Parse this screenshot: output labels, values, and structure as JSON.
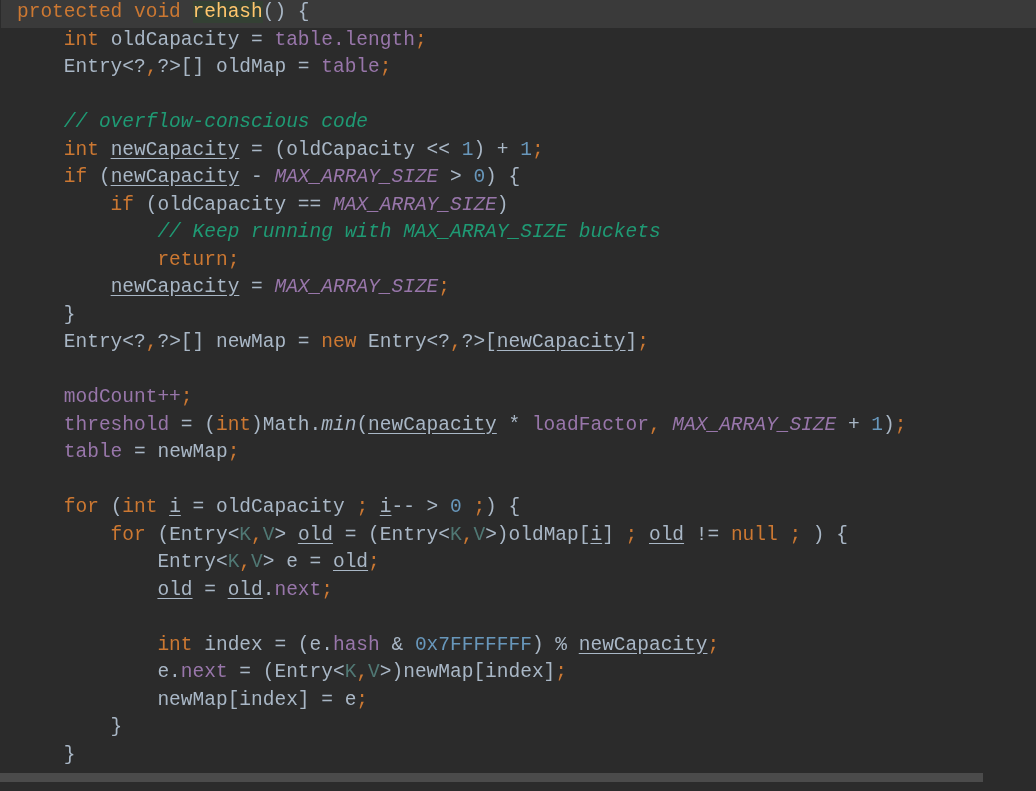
{
  "editor": {
    "lines": [
      {
        "current": true,
        "tokens": [
          {
            "kind": "keyword",
            "text": "protected void "
          },
          {
            "kind": "method_declaration",
            "text": "rehash"
          },
          {
            "kind": "plain",
            "text": "() {"
          }
        ]
      },
      {
        "current": false,
        "tokens": [
          {
            "kind": "keyword",
            "text": "    int "
          },
          {
            "kind": "plain",
            "text": "oldCapacity = "
          },
          {
            "kind": "field",
            "text": "table.length"
          },
          {
            "kind": "keyword",
            "text": ";"
          }
        ]
      },
      {
        "current": false,
        "tokens": [
          {
            "kind": "plain",
            "text": "    Entry<?"
          },
          {
            "kind": "keyword",
            "text": ","
          },
          {
            "kind": "plain",
            "text": "?>[] oldMap = "
          },
          {
            "kind": "field",
            "text": "table"
          },
          {
            "kind": "keyword",
            "text": ";"
          }
        ]
      },
      {
        "current": false
      },
      {
        "current": false,
        "tokens": [
          {
            "kind": "comment",
            "text": "    // overflow-conscious code"
          }
        ]
      },
      {
        "current": false,
        "tokens": [
          {
            "kind": "keyword",
            "text": "    int "
          },
          {
            "kind": "reassigned",
            "text": "newCapacity"
          },
          {
            "kind": "plain",
            "text": " = (oldCapacity << "
          },
          {
            "kind": "number",
            "text": "1"
          },
          {
            "kind": "plain",
            "text": ") + "
          },
          {
            "kind": "number",
            "text": "1"
          },
          {
            "kind": "keyword",
            "text": ";"
          }
        ]
      },
      {
        "current": false,
        "tokens": [
          {
            "kind": "keyword",
            "text": "    if "
          },
          {
            "kind": "plain",
            "text": "("
          },
          {
            "kind": "reassigned",
            "text": "newCapacity"
          },
          {
            "kind": "plain",
            "text": " - "
          },
          {
            "kind": "constant",
            "text": "MAX_ARRAY_SIZE"
          },
          {
            "kind": "plain",
            "text": " > "
          },
          {
            "kind": "number",
            "text": "0"
          },
          {
            "kind": "plain",
            "text": ") {"
          }
        ]
      },
      {
        "current": false,
        "tokens": [
          {
            "kind": "keyword",
            "text": "        if "
          },
          {
            "kind": "plain",
            "text": "(oldCapacity == "
          },
          {
            "kind": "constant",
            "text": "MAX_ARRAY_SIZE"
          },
          {
            "kind": "plain",
            "text": ")"
          }
        ]
      },
      {
        "current": false,
        "tokens": [
          {
            "kind": "comment",
            "text": "            // Keep running with MAX_ARRAY_SIZE buckets"
          }
        ]
      },
      {
        "current": false,
        "tokens": [
          {
            "kind": "keyword",
            "text": "            return;"
          }
        ]
      },
      {
        "current": false,
        "tokens": [
          {
            "kind": "reassigned",
            "text": "        newCapacity"
          },
          {
            "kind": "plain",
            "text": " = "
          },
          {
            "kind": "constant",
            "text": "MAX_ARRAY_SIZE"
          },
          {
            "kind": "keyword",
            "text": ";"
          }
        ]
      },
      {
        "current": false,
        "tokens": [
          {
            "kind": "plain",
            "text": "    }"
          }
        ]
      },
      {
        "current": false,
        "tokens": [
          {
            "kind": "plain",
            "text": "    Entry<?"
          },
          {
            "kind": "keyword",
            "text": ","
          },
          {
            "kind": "plain",
            "text": "?>[] newMap = "
          },
          {
            "kind": "keyword",
            "text": "new "
          },
          {
            "kind": "plain",
            "text": "Entry<?"
          },
          {
            "kind": "keyword",
            "text": ","
          },
          {
            "kind": "plain",
            "text": "?>["
          },
          {
            "kind": "reassigned",
            "text": "newCapacity"
          },
          {
            "kind": "plain",
            "text": "]"
          },
          {
            "kind": "keyword",
            "text": ";"
          }
        ]
      },
      {
        "current": false
      },
      {
        "current": false,
        "tokens": [
          {
            "kind": "field",
            "text": "    modCount++"
          },
          {
            "kind": "keyword",
            "text": ";"
          }
        ]
      },
      {
        "current": false,
        "tokens": [
          {
            "kind": "field",
            "text": "    threshold"
          },
          {
            "kind": "plain",
            "text": " = ("
          },
          {
            "kind": "keyword",
            "text": "int"
          },
          {
            "kind": "plain",
            "text": ")Math."
          },
          {
            "kind": "static_method",
            "text": "min"
          },
          {
            "kind": "plain",
            "text": "("
          },
          {
            "kind": "reassigned",
            "text": "newCapacity"
          },
          {
            "kind": "plain",
            "text": " * "
          },
          {
            "kind": "field",
            "text": "loadFactor"
          },
          {
            "kind": "keyword",
            "text": ", "
          },
          {
            "kind": "constant",
            "text": "MAX_ARRAY_SIZE"
          },
          {
            "kind": "plain",
            "text": " + "
          },
          {
            "kind": "number",
            "text": "1"
          },
          {
            "kind": "plain",
            "text": ")"
          },
          {
            "kind": "keyword",
            "text": ";"
          }
        ]
      },
      {
        "current": false,
        "tokens": [
          {
            "kind": "field",
            "text": "    table"
          },
          {
            "kind": "plain",
            "text": " = newMap"
          },
          {
            "kind": "keyword",
            "text": ";"
          }
        ]
      },
      {
        "current": false
      },
      {
        "current": false,
        "tokens": [
          {
            "kind": "keyword",
            "text": "    for "
          },
          {
            "kind": "plain",
            "text": "("
          },
          {
            "kind": "keyword",
            "text": "int "
          },
          {
            "kind": "reassigned",
            "text": "i"
          },
          {
            "kind": "plain",
            "text": " = oldCapacity "
          },
          {
            "kind": "keyword",
            "text": "; "
          },
          {
            "kind": "reassigned",
            "text": "i"
          },
          {
            "kind": "plain",
            "text": "-- > "
          },
          {
            "kind": "number",
            "text": "0"
          },
          {
            "kind": "keyword",
            "text": " ;"
          },
          {
            "kind": "plain",
            "text": ") {"
          }
        ]
      },
      {
        "current": false,
        "tokens": [
          {
            "kind": "keyword",
            "text": "        for "
          },
          {
            "kind": "plain",
            "text": "(Entry<"
          },
          {
            "kind": "type_parameter",
            "text": "K"
          },
          {
            "kind": "keyword",
            "text": ","
          },
          {
            "kind": "type_parameter",
            "text": "V"
          },
          {
            "kind": "plain",
            "text": "> "
          },
          {
            "kind": "reassigned",
            "text": "old"
          },
          {
            "kind": "plain",
            "text": " = (Entry<"
          },
          {
            "kind": "type_parameter",
            "text": "K"
          },
          {
            "kind": "keyword",
            "text": ","
          },
          {
            "kind": "type_parameter",
            "text": "V"
          },
          {
            "kind": "plain",
            "text": ">)oldMap["
          },
          {
            "kind": "reassigned",
            "text": "i"
          },
          {
            "kind": "plain",
            "text": "] "
          },
          {
            "kind": "keyword",
            "text": "; "
          },
          {
            "kind": "reassigned",
            "text": "old"
          },
          {
            "kind": "plain",
            "text": " != "
          },
          {
            "kind": "keyword",
            "text": "null ;"
          },
          {
            "kind": "plain",
            "text": " ) {"
          }
        ]
      },
      {
        "current": false,
        "tokens": [
          {
            "kind": "plain",
            "text": "            Entry<"
          },
          {
            "kind": "type_parameter",
            "text": "K"
          },
          {
            "kind": "keyword",
            "text": ","
          },
          {
            "kind": "type_parameter",
            "text": "V"
          },
          {
            "kind": "plain",
            "text": "> e = "
          },
          {
            "kind": "reassigned",
            "text": "old"
          },
          {
            "kind": "keyword",
            "text": ";"
          }
        ]
      },
      {
        "current": false,
        "tokens": [
          {
            "kind": "reassigned",
            "text": "            old"
          },
          {
            "kind": "plain",
            "text": " = "
          },
          {
            "kind": "reassigned",
            "text": "old"
          },
          {
            "kind": "plain",
            "text": "."
          },
          {
            "kind": "field",
            "text": "next"
          },
          {
            "kind": "keyword",
            "text": ";"
          }
        ]
      },
      {
        "current": false
      },
      {
        "current": false,
        "tokens": [
          {
            "kind": "keyword",
            "text": "            int "
          },
          {
            "kind": "plain",
            "text": "index = (e."
          },
          {
            "kind": "field",
            "text": "hash"
          },
          {
            "kind": "plain",
            "text": " & "
          },
          {
            "kind": "number",
            "text": "0x7FFFFFFF"
          },
          {
            "kind": "plain",
            "text": ") % "
          },
          {
            "kind": "reassigned",
            "text": "newCapacity"
          },
          {
            "kind": "keyword",
            "text": ";"
          }
        ]
      },
      {
        "current": false,
        "tokens": [
          {
            "kind": "plain",
            "text": "            e."
          },
          {
            "kind": "field",
            "text": "next"
          },
          {
            "kind": "plain",
            "text": " = (Entry<"
          },
          {
            "kind": "type_parameter",
            "text": "K"
          },
          {
            "kind": "keyword",
            "text": ","
          },
          {
            "kind": "type_parameter",
            "text": "V"
          },
          {
            "kind": "plain",
            "text": ">)newMap[index]"
          },
          {
            "kind": "keyword",
            "text": ";"
          }
        ]
      },
      {
        "current": false,
        "tokens": [
          {
            "kind": "plain",
            "text": "            newMap[index] = e"
          },
          {
            "kind": "keyword",
            "text": ";"
          }
        ]
      },
      {
        "current": false,
        "tokens": [
          {
            "kind": "plain",
            "text": "        }"
          }
        ]
      },
      {
        "current": false,
        "tokens": [
          {
            "kind": "plain",
            "text": "    }"
          }
        ]
      }
    ]
  }
}
